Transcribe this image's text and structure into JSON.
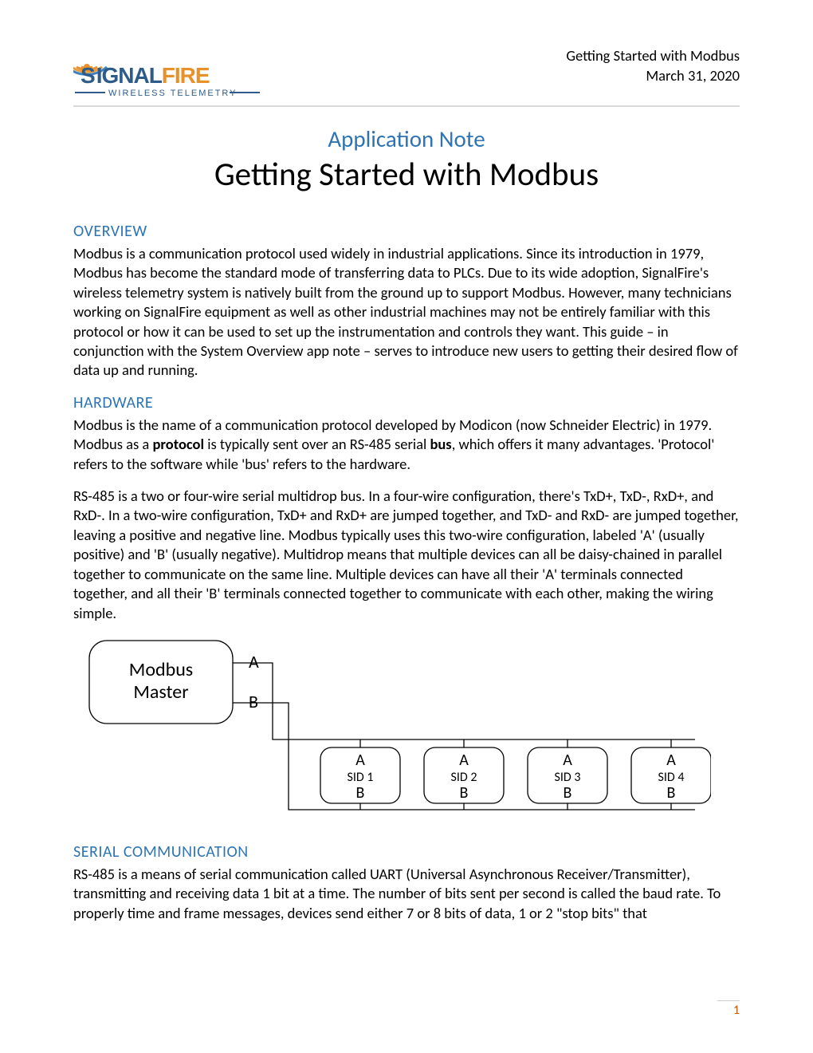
{
  "header": {
    "logo_brand_pre": "S",
    "logo_brand_mid": "GNAL",
    "logo_brand_end": "FIRE",
    "logo_tagline": "WIRELESS  TELEMETRY",
    "title_line1": "Getting Started with Modbus",
    "date": "March 31, 2020"
  },
  "titles": {
    "app_note": "Application Note",
    "doc_title": "Getting Started with Modbus"
  },
  "sections": {
    "overview": {
      "heading": "OVERVIEW",
      "p1": "Modbus is a communication protocol used widely in industrial applications. Since its introduction in 1979, Modbus has become the standard mode of transferring data to PLCs. Due to its wide adoption, SignalFire's wireless telemetry system is natively built from the ground up to support Modbus. However, many technicians working on SignalFire equipment as well as other industrial machines may not be entirely familiar with this protocol or how it can be used to set up the instrumentation and controls they want. This guide – in conjunction with the System Overview app note – serves to introduce new users to getting their desired flow of data up and running."
    },
    "hardware": {
      "heading": "HARDWARE",
      "p1_a": "Modbus is the name of a communication protocol developed by Modicon (now Schneider Electric) in 1979. Modbus as a ",
      "p1_b": "protocol",
      "p1_c": " is typically sent over an RS-485 serial ",
      "p1_d": "bus",
      "p1_e": ", which offers it many advantages. 'Protocol' refers to the software while 'bus' refers to the hardware.",
      "p2": "RS-485 is a two or four-wire serial multidrop bus. In a four-wire configuration, there's TxD+, TxD-, RxD+, and RxD-. In a two-wire configuration, TxD+ and RxD+ are jumped together, and TxD- and RxD- are jumped together, leaving a positive and negative line. Modbus typically uses this two-wire configuration, labeled 'A' (usually positive) and 'B' (usually negative). Multidrop means that multiple devices can all be daisy-chained in parallel together to communicate on the same line. Multiple devices can have all their 'A' terminals connected together, and all their 'B' terminals connected together to communicate with each other, making the wiring simple."
    },
    "serial": {
      "heading": "SERIAL COMMUNICATION",
      "p1": "RS-485 is a means of serial communication called UART (Universal Asynchronous Receiver/Transmitter), transmitting and receiving data 1 bit at a time. The number of bits sent per second is called the baud rate. To properly time and frame messages, devices send either 7 or 8 bits of data, 1 or 2 \"stop bits\" that"
    }
  },
  "diagram": {
    "master_line1": "Modbus",
    "master_line2": "Master",
    "pin_a": "A",
    "pin_b": "B",
    "slaves": [
      "SID 1",
      "SID 2",
      "SID 3",
      "SID 4"
    ]
  },
  "footer": {
    "page": "1"
  }
}
